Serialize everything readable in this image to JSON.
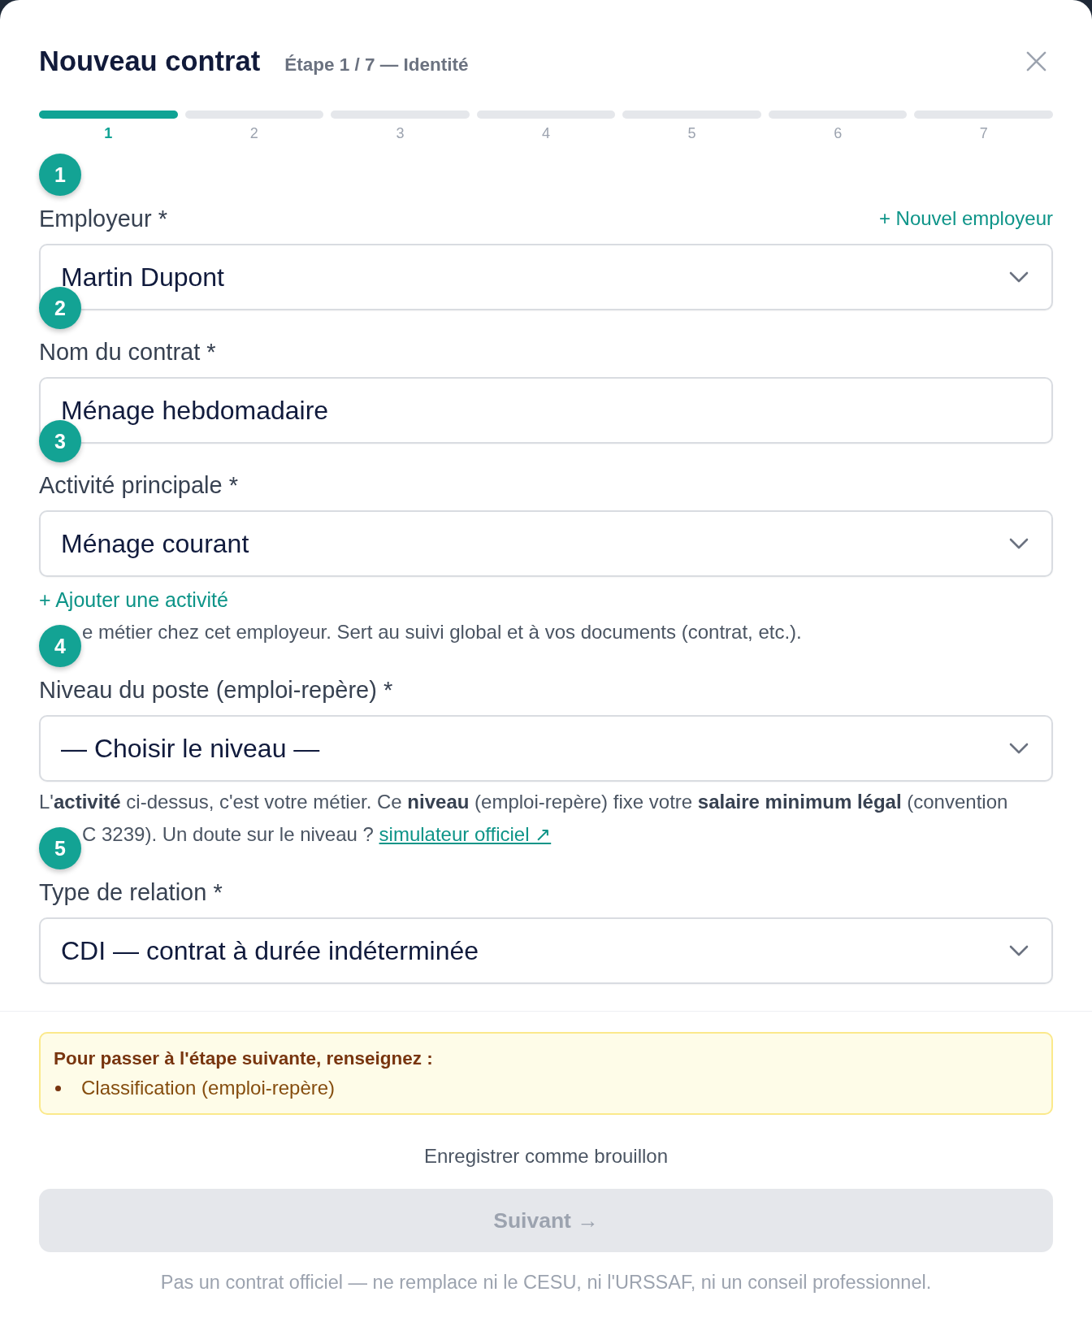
{
  "dialog": {
    "title": "Nouveau contrat",
    "subtitle": "Étape 1 / 7 — Identité"
  },
  "stepper": [
    {
      "label": "1",
      "selected": true
    },
    {
      "label": "2",
      "selected": false
    },
    {
      "label": "3",
      "selected": false
    },
    {
      "label": "4",
      "selected": false
    },
    {
      "label": "5",
      "selected": false
    },
    {
      "label": "6",
      "selected": false
    },
    {
      "label": "7",
      "selected": false
    }
  ],
  "fields": [
    {
      "marker": "1",
      "label": "Employeur *",
      "kind": "select",
      "value": "Martin Dupont",
      "action": "+ Nouvel employeur"
    },
    {
      "marker": "2",
      "label": "Nom du contrat *",
      "kind": "text",
      "value": "Ménage hebdomadaire"
    },
    {
      "marker": "3",
      "label": "Activité principale *",
      "kind": "select",
      "value": "Ménage courant",
      "add_link": "+ Ajouter une activité",
      "help": [
        {
          "text": "e métier chez cet employeur. Sert au suivi global et à vos documents (contrat, etc.).",
          "covered_start": true
        }
      ]
    },
    {
      "marker": "4",
      "label": "Niveau du poste (emploi-repère) *",
      "kind": "select",
      "value": "— Choisir le niveau —",
      "help": [
        {
          "text": "L'**activité** ci-dessus, c'est votre métier. Ce **niveau** (emploi-repère) fixe votre **salaire minimum légal** (convention",
          "covered_start": false
        },
        {
          "text": "C 3239). Un doute sur le niveau ?",
          "covered_start": true,
          "link": "simulateur officiel ↗"
        }
      ]
    },
    {
      "marker": "5",
      "label": "Type de relation *",
      "kind": "select",
      "value": "CDI — contrat à durée indéterminée"
    }
  ],
  "notice": {
    "title": "Pour passer à l'étape suivante, renseignez :",
    "items": [
      "Classification (emploi-repère)"
    ]
  },
  "draft_button": "Enregistrer comme brouillon",
  "next_button": {
    "label": "Suivant →",
    "disabled": true
  },
  "disclaimer": "Pas un contrat officiel — ne remplace ni le CESU, ni l'URSSAF, ni un conseil professionnel."
}
